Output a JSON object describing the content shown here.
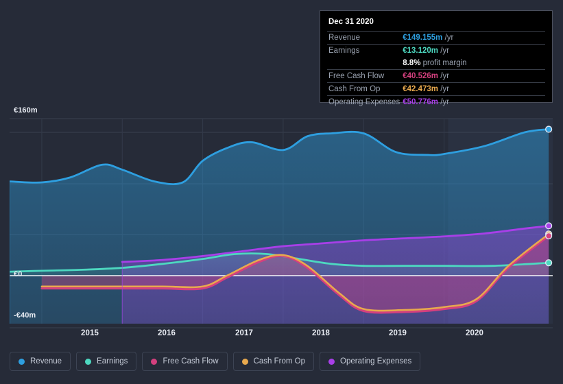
{
  "chart_data": {
    "type": "area",
    "title": "",
    "xlabel": "",
    "ylabel": "",
    "currency": "EUR",
    "units": "millions",
    "grid": true,
    "legend_position": "bottom",
    "ylim": [
      -40,
      160
    ],
    "y_ticks": [
      {
        "label": "€160m",
        "value": 160
      },
      {
        "label": "€0",
        "value": 0
      },
      {
        "label": "-€40m",
        "value": -40
      }
    ],
    "x_ticks": [
      "2015",
      "2016",
      "2017",
      "2018",
      "2019",
      "2020"
    ],
    "x_range": [
      "2014-07",
      "2021-06"
    ],
    "series": [
      {
        "name": "Revenue",
        "color": "#2e9fe0",
        "x": [
          2014.6,
          2015.0,
          2015.35,
          2015.75,
          2016.0,
          2016.4,
          2016.75,
          2017.0,
          2017.3,
          2017.6,
          2018.0,
          2018.3,
          2018.6,
          2019.0,
          2019.4,
          2019.8,
          2020.0,
          2020.5,
          2021.0,
          2021.3
        ],
        "values": [
          96,
          95,
          100,
          113,
          108,
          96,
          95,
          117,
          130,
          136,
          128,
          142,
          145,
          145,
          126,
          123,
          124,
          132,
          146,
          149.155
        ]
      },
      {
        "name": "Earnings",
        "color": "#4dd8c0",
        "x": [
          2014.6,
          2015.0,
          2015.5,
          2016.0,
          2016.5,
          2017.0,
          2017.4,
          2017.8,
          2018.2,
          2018.6,
          2019.0,
          2019.5,
          2020.0,
          2020.6,
          2021.3
        ],
        "values": [
          4,
          5,
          6,
          8,
          12,
          17,
          22,
          22,
          17,
          12,
          10,
          10,
          10,
          10,
          13.12
        ]
      },
      {
        "name": "Free Cash Flow",
        "color": "#d4407e",
        "x": [
          2015.0,
          2015.5,
          2016.0,
          2016.5,
          2017.0,
          2017.3,
          2017.7,
          2018.0,
          2018.3,
          2018.7,
          2019.0,
          2019.5,
          2020.0,
          2020.4,
          2020.8,
          2021.3
        ],
        "values": [
          -13,
          -13,
          -13,
          -13,
          -13,
          -2,
          14,
          20,
          8,
          -20,
          -36,
          -37,
          -34,
          -26,
          8,
          40.526
        ]
      },
      {
        "name": "Cash From Op",
        "color": "#e8a94e",
        "x": [
          2015.0,
          2015.5,
          2016.0,
          2016.5,
          2017.0,
          2017.3,
          2017.7,
          2018.0,
          2018.3,
          2018.7,
          2019.0,
          2019.5,
          2020.0,
          2020.4,
          2020.8,
          2021.3
        ],
        "values": [
          -11,
          -11,
          -11,
          -11,
          -11,
          0,
          16,
          21,
          10,
          -18,
          -34,
          -35,
          -32,
          -24,
          10,
          42.473
        ]
      },
      {
        "name": "Operating Expenses",
        "color": "#a83fe8",
        "x": [
          2016.0,
          2016.5,
          2017.0,
          2017.5,
          2018.0,
          2018.5,
          2019.0,
          2019.5,
          2020.0,
          2020.5,
          2021.0,
          2021.3
        ],
        "values": [
          14,
          16,
          20,
          25,
          30,
          33,
          36,
          38,
          40,
          43,
          48,
          50.776
        ]
      }
    ]
  },
  "tooltip": {
    "title": "Dec 31 2020",
    "rows": [
      {
        "name": "Revenue",
        "value": "€149.155m",
        "unit": "/yr",
        "color": "#2e9fe0"
      },
      {
        "name": "Earnings",
        "value": "€13.120m",
        "unit": "/yr",
        "color": "#4dd8c0"
      },
      {
        "name": "",
        "value": "8.8%",
        "unit": "profit margin",
        "color": "#ffffff"
      },
      {
        "name": "Free Cash Flow",
        "value": "€40.526m",
        "unit": "/yr",
        "color": "#d4407e"
      },
      {
        "name": "Cash From Op",
        "value": "€42.473m",
        "unit": "/yr",
        "color": "#e8a94e"
      },
      {
        "name": "Operating Expenses",
        "value": "€50.776m",
        "unit": "/yr",
        "color": "#a83fe8"
      }
    ]
  },
  "legend": {
    "items": [
      {
        "label": "Revenue",
        "color": "#2e9fe0"
      },
      {
        "label": "Earnings",
        "color": "#4dd8c0"
      },
      {
        "label": "Free Cash Flow",
        "color": "#d4407e"
      },
      {
        "label": "Cash From Op",
        "color": "#e8a94e"
      },
      {
        "label": "Operating Expenses",
        "color": "#a83fe8"
      }
    ]
  },
  "colors": {
    "background": "#262b38",
    "grid": "#3a4050",
    "zero_line": "#ffffff",
    "axis_text": "#e8ecf3"
  }
}
